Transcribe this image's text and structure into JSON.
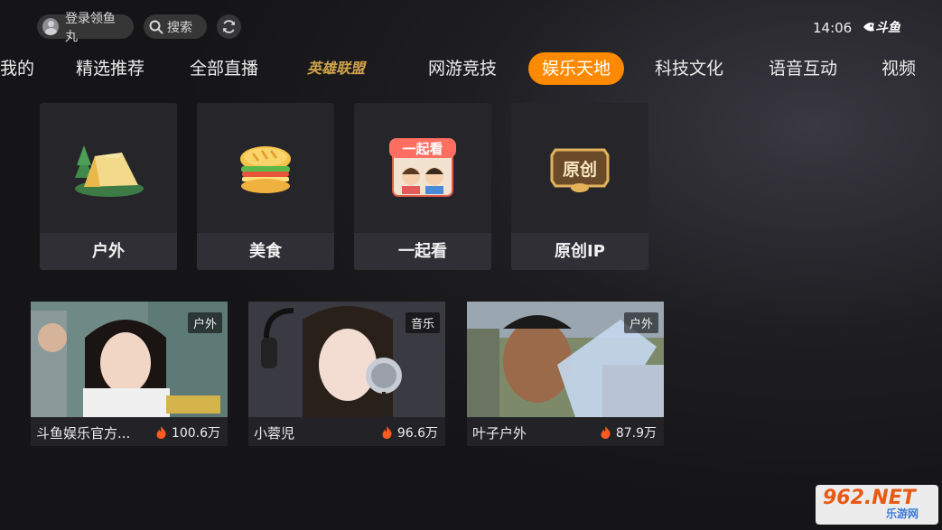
{
  "topbar": {
    "login_label": "登录领鱼丸",
    "search_label": "搜索",
    "time": "14:06",
    "brand": "斗鱼"
  },
  "tabs": [
    {
      "label": "我的"
    },
    {
      "label": "精选推荐"
    },
    {
      "label": "全部直播"
    },
    {
      "label": "英雄联盟"
    },
    {
      "label": "网游竞技"
    },
    {
      "label": "娱乐天地",
      "active": true
    },
    {
      "label": "科技文化"
    },
    {
      "label": "语音互动"
    },
    {
      "label": "视频"
    }
  ],
  "categories": [
    {
      "label": "户外",
      "icon": "tent-icon"
    },
    {
      "label": "美食",
      "icon": "sandwich-icon"
    },
    {
      "label": "一起看",
      "icon": "watch-together-icon",
      "art_text": "一起看"
    },
    {
      "label": "原创IP",
      "icon": "original-ip-icon",
      "art_text": "原创"
    }
  ],
  "streams": [
    {
      "tag": "户外",
      "name": "斗鱼娱乐官方...",
      "heat": "100.6万"
    },
    {
      "tag": "音乐",
      "name": "小蓉児",
      "heat": "96.6万"
    },
    {
      "tag": "户外",
      "name": "叶子户外",
      "heat": "87.9万"
    }
  ],
  "watermark": {
    "big": "962.NET",
    "small": "乐游网"
  },
  "colors": {
    "accent": "#ff8a00",
    "card": "#25252a",
    "heat": "#ff5a1f"
  }
}
